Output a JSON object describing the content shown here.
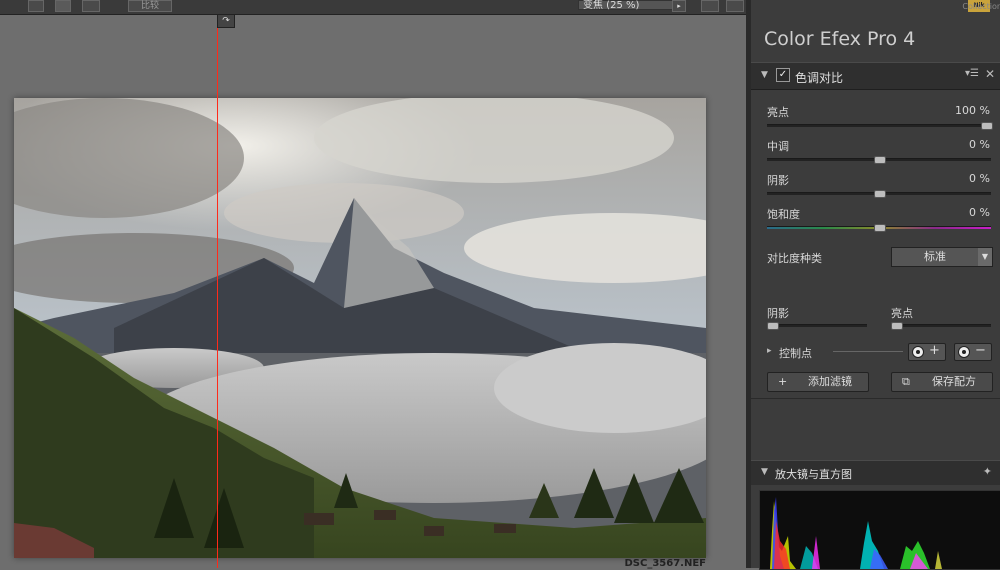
{
  "toolbar": {
    "compare_label": "比较",
    "zoom_label": "变焦 (25 %)",
    "zoom_arrow": "▸",
    "split_handle_glyph": "↷"
  },
  "image": {
    "filename": "DSC_3567.NEF"
  },
  "panel": {
    "brand_badge": "Nik",
    "collection": "Collection",
    "app_title": "Color Efex Pro",
    "app_version": "4",
    "filter": {
      "name": "色调对比",
      "enabled_glyph": "✓",
      "expand_glyph": "▼",
      "menu_glyph": "▾☰",
      "close_glyph": "✕",
      "params": [
        {
          "label": "亮点",
          "value": "100 %",
          "level": 1.0
        },
        {
          "label": "中调",
          "value": "0 %",
          "level": 0.5
        },
        {
          "label": "阴影",
          "value": "0 %",
          "level": 0.5
        },
        {
          "label": "饱和度",
          "value": "0 %",
          "level": 0.5
        }
      ],
      "contrast_type_label": "对比度种类",
      "contrast_type_value": "标准",
      "shadow_label": "阴影",
      "highlight_label": "亮点",
      "shadow_level": 0.0,
      "highlight_level": 0.0
    },
    "control_points": {
      "label": "控制点",
      "add_glyph": "+",
      "remove_glyph": "−",
      "arrow_glyph": "▸"
    },
    "add_filter": {
      "label": "添加滤镜",
      "icon": "+"
    },
    "save_recipe": {
      "label": "保存配方",
      "icon": "⧉"
    },
    "loupe": {
      "title": "放大镜与直方图",
      "arrow_glyph": "▼",
      "pin_glyph": "✦"
    }
  }
}
